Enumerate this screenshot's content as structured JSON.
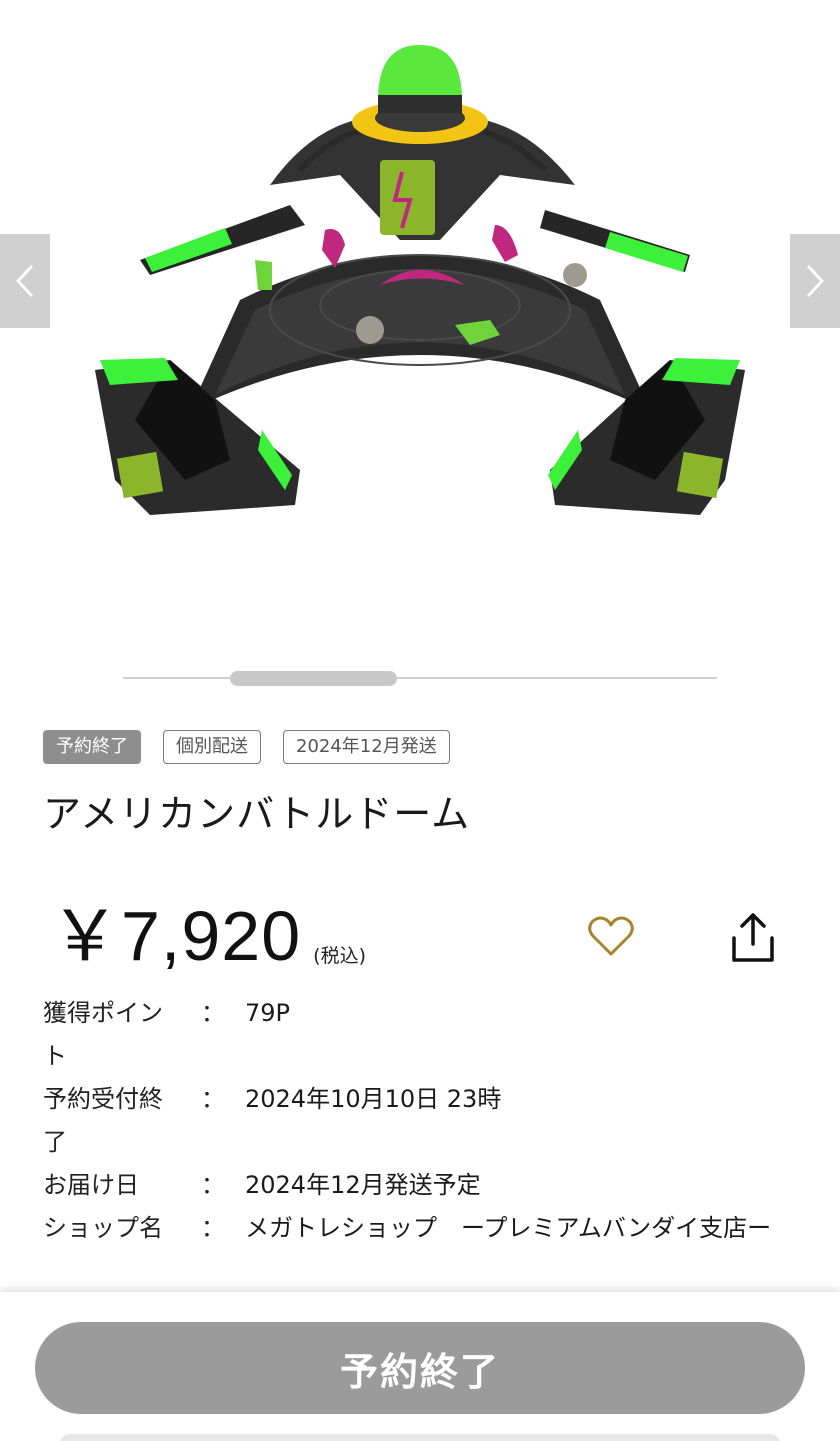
{
  "carousel": {
    "image_alt": "",
    "prev_icon": "chevron-left-icon",
    "next_icon": "chevron-right-icon",
    "scroll_position": 0.2
  },
  "tags": [
    {
      "label": "予約終了",
      "style": "filled"
    },
    {
      "label": "個別配送",
      "style": "outline"
    },
    {
      "label": "2024年12月発送",
      "style": "outline"
    }
  ],
  "product": {
    "title": "アメリカンバトルドーム",
    "price": "￥7,920",
    "tax_note": "(税込)",
    "favorite_icon": "heart-outline-icon",
    "share_icon": "share-icon"
  },
  "info": [
    {
      "label": "獲得ポイント",
      "sep": "：",
      "value": "79P"
    },
    {
      "label": "予約受付終了",
      "sep": "：",
      "value": "2024年10月10日 23時"
    },
    {
      "label": "お届け日",
      "sep": "：",
      "value": "2024年12月発送予定"
    },
    {
      "label": "ショップ名",
      "sep": "：",
      "value": "メガトレショップ　ープレミアムバンダイ支店ー"
    }
  ],
  "bottom": {
    "button_label": "予約終了"
  },
  "colors": {
    "accent_heart": "#a9822c",
    "disabled_button": "#9b9b9b",
    "tag_filled": "#8e8e8e",
    "neon_green": "#3df03a",
    "magenta": "#c0277f"
  }
}
